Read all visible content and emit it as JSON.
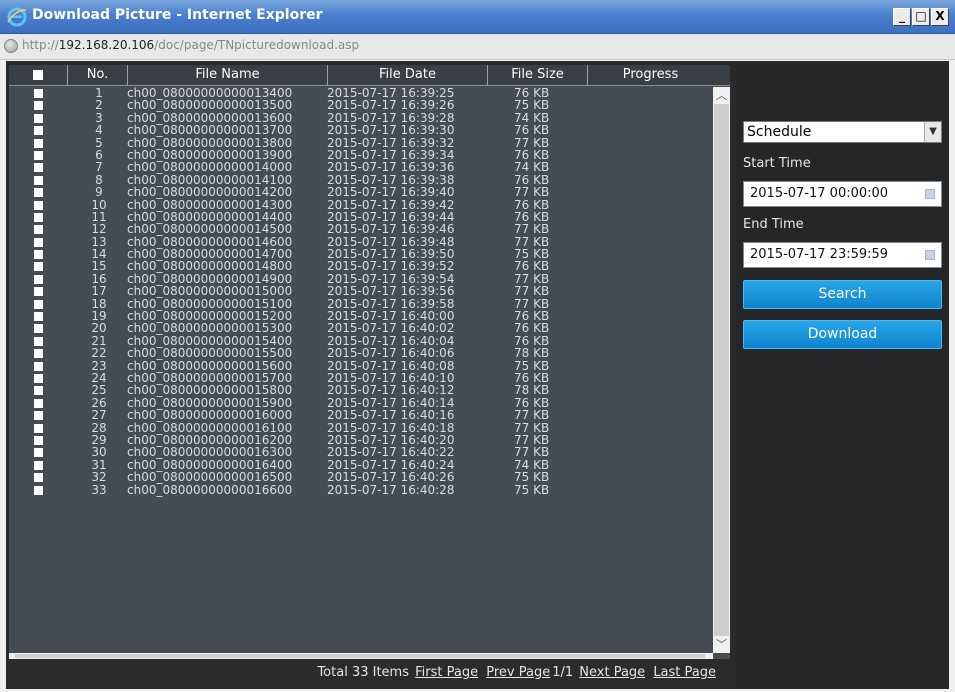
{
  "window": {
    "title": "Download Picture - Internet Explorer",
    "url_prefix": "http://",
    "url_host": "192.168.20.106",
    "url_path": "/doc/page/TNpicturedownload.asp",
    "min_label": "_",
    "max_label": "□",
    "close_label": "X"
  },
  "table": {
    "headers": {
      "no": "No.",
      "file_name": "File Name",
      "file_date": "File Date",
      "file_size": "File Size",
      "progress": "Progress"
    },
    "rows": [
      {
        "no": "1",
        "name": "ch00_08000000000013400",
        "date": "2015-07-17 16:39:25",
        "size": "76 KB"
      },
      {
        "no": "2",
        "name": "ch00_08000000000013500",
        "date": "2015-07-17 16:39:26",
        "size": "75 KB"
      },
      {
        "no": "3",
        "name": "ch00_08000000000013600",
        "date": "2015-07-17 16:39:28",
        "size": "74 KB"
      },
      {
        "no": "4",
        "name": "ch00_08000000000013700",
        "date": "2015-07-17 16:39:30",
        "size": "76 KB"
      },
      {
        "no": "5",
        "name": "ch00_08000000000013800",
        "date": "2015-07-17 16:39:32",
        "size": "77 KB"
      },
      {
        "no": "6",
        "name": "ch00_08000000000013900",
        "date": "2015-07-17 16:39:34",
        "size": "76 KB"
      },
      {
        "no": "7",
        "name": "ch00_08000000000014000",
        "date": "2015-07-17 16:39:36",
        "size": "74 KB"
      },
      {
        "no": "8",
        "name": "ch00_08000000000014100",
        "date": "2015-07-17 16:39:38",
        "size": "76 KB"
      },
      {
        "no": "9",
        "name": "ch00_08000000000014200",
        "date": "2015-07-17 16:39:40",
        "size": "77 KB"
      },
      {
        "no": "10",
        "name": "ch00_08000000000014300",
        "date": "2015-07-17 16:39:42",
        "size": "76 KB"
      },
      {
        "no": "11",
        "name": "ch00_08000000000014400",
        "date": "2015-07-17 16:39:44",
        "size": "76 KB"
      },
      {
        "no": "12",
        "name": "ch00_08000000000014500",
        "date": "2015-07-17 16:39:46",
        "size": "77 KB"
      },
      {
        "no": "13",
        "name": "ch00_08000000000014600",
        "date": "2015-07-17 16:39:48",
        "size": "77 KB"
      },
      {
        "no": "14",
        "name": "ch00_08000000000014700",
        "date": "2015-07-17 16:39:50",
        "size": "75 KB"
      },
      {
        "no": "15",
        "name": "ch00_08000000000014800",
        "date": "2015-07-17 16:39:52",
        "size": "76 KB"
      },
      {
        "no": "16",
        "name": "ch00_08000000000014900",
        "date": "2015-07-17 16:39:54",
        "size": "77 KB"
      },
      {
        "no": "17",
        "name": "ch00_08000000000015000",
        "date": "2015-07-17 16:39:56",
        "size": "77 KB"
      },
      {
        "no": "18",
        "name": "ch00_08000000000015100",
        "date": "2015-07-17 16:39:58",
        "size": "77 KB"
      },
      {
        "no": "19",
        "name": "ch00_08000000000015200",
        "date": "2015-07-17 16:40:00",
        "size": "76 KB"
      },
      {
        "no": "20",
        "name": "ch00_08000000000015300",
        "date": "2015-07-17 16:40:02",
        "size": "76 KB"
      },
      {
        "no": "21",
        "name": "ch00_08000000000015400",
        "date": "2015-07-17 16:40:04",
        "size": "76 KB"
      },
      {
        "no": "22",
        "name": "ch00_08000000000015500",
        "date": "2015-07-17 16:40:06",
        "size": "78 KB"
      },
      {
        "no": "23",
        "name": "ch00_08000000000015600",
        "date": "2015-07-17 16:40:08",
        "size": "75 KB"
      },
      {
        "no": "24",
        "name": "ch00_08000000000015700",
        "date": "2015-07-17 16:40:10",
        "size": "76 KB"
      },
      {
        "no": "25",
        "name": "ch00_08000000000015800",
        "date": "2015-07-17 16:40:12",
        "size": "78 KB"
      },
      {
        "no": "26",
        "name": "ch00_08000000000015900",
        "date": "2015-07-17 16:40:14",
        "size": "76 KB"
      },
      {
        "no": "27",
        "name": "ch00_08000000000016000",
        "date": "2015-07-17 16:40:16",
        "size": "77 KB"
      },
      {
        "no": "28",
        "name": "ch00_08000000000016100",
        "date": "2015-07-17 16:40:18",
        "size": "77 KB"
      },
      {
        "no": "29",
        "name": "ch00_08000000000016200",
        "date": "2015-07-17 16:40:20",
        "size": "77 KB"
      },
      {
        "no": "30",
        "name": "ch00_08000000000016300",
        "date": "2015-07-17 16:40:22",
        "size": "77 KB"
      },
      {
        "no": "31",
        "name": "ch00_08000000000016400",
        "date": "2015-07-17 16:40:24",
        "size": "74 KB"
      },
      {
        "no": "32",
        "name": "ch00_08000000000016500",
        "date": "2015-07-17 16:40:26",
        "size": "75 KB"
      },
      {
        "no": "33",
        "name": "ch00_08000000000016600",
        "date": "2015-07-17 16:40:28",
        "size": "75 KB"
      }
    ]
  },
  "pager": {
    "total": "Total 33 Items",
    "first": "First Page",
    "prev": "Prev Page",
    "page": "1/1",
    "next": "Next Page",
    "last": "Last Page"
  },
  "search": {
    "type_value": "Schedule",
    "start_label": "Start Time",
    "start_value": "2015-07-17 00:00:00",
    "end_label": "End Time",
    "end_value": "2015-07-17 23:59:59",
    "search_label": "Search",
    "download_label": "Download"
  }
}
